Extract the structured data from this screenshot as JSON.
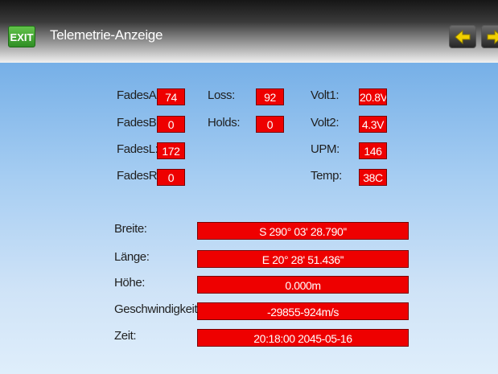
{
  "header": {
    "exit_label": "EXIT",
    "title": "Telemetrie-Anzeige",
    "prev_icon": "arrow-left-icon",
    "next_icon": "arrow-right-icon",
    "accent_color": "#3f9f2d",
    "nav_arrow_color": "#f0d000"
  },
  "stats": {
    "fades_a": {
      "label": "FadesA:",
      "value": "74"
    },
    "fades_b": {
      "label": "FadesB:",
      "value": "0"
    },
    "fades_l": {
      "label": "FadesL:",
      "value": "172"
    },
    "fades_r": {
      "label": "FadesR:",
      "value": "0"
    },
    "loss": {
      "label": "Loss:",
      "value": "92"
    },
    "holds": {
      "label": "Holds:",
      "value": "0"
    },
    "volt1": {
      "label": "Volt1:",
      "value": "20.8V"
    },
    "volt2": {
      "label": "Volt2:",
      "value": "4.3V"
    },
    "upm": {
      "label": "UPM:",
      "value": "146"
    },
    "temp": {
      "label": "Temp:",
      "value": "38C"
    }
  },
  "gps": {
    "breite": {
      "label": "Breite:",
      "value": "S 290° 03' 28.790''"
    },
    "laenge": {
      "label": "Länge:",
      "value": "E  20° 28' 51.436''"
    },
    "hoehe": {
      "label": "Höhe:",
      "value": "0.000m"
    },
    "geschwindigkeit": {
      "label": "Geschwindigkeit",
      "value": "-29855-924m/s"
    },
    "zeit": {
      "label": "Zeit:",
      "value": "20:18:00 2045-05-16"
    }
  },
  "colors": {
    "value_box": "#ee0000",
    "value_text": "#ffffff"
  }
}
